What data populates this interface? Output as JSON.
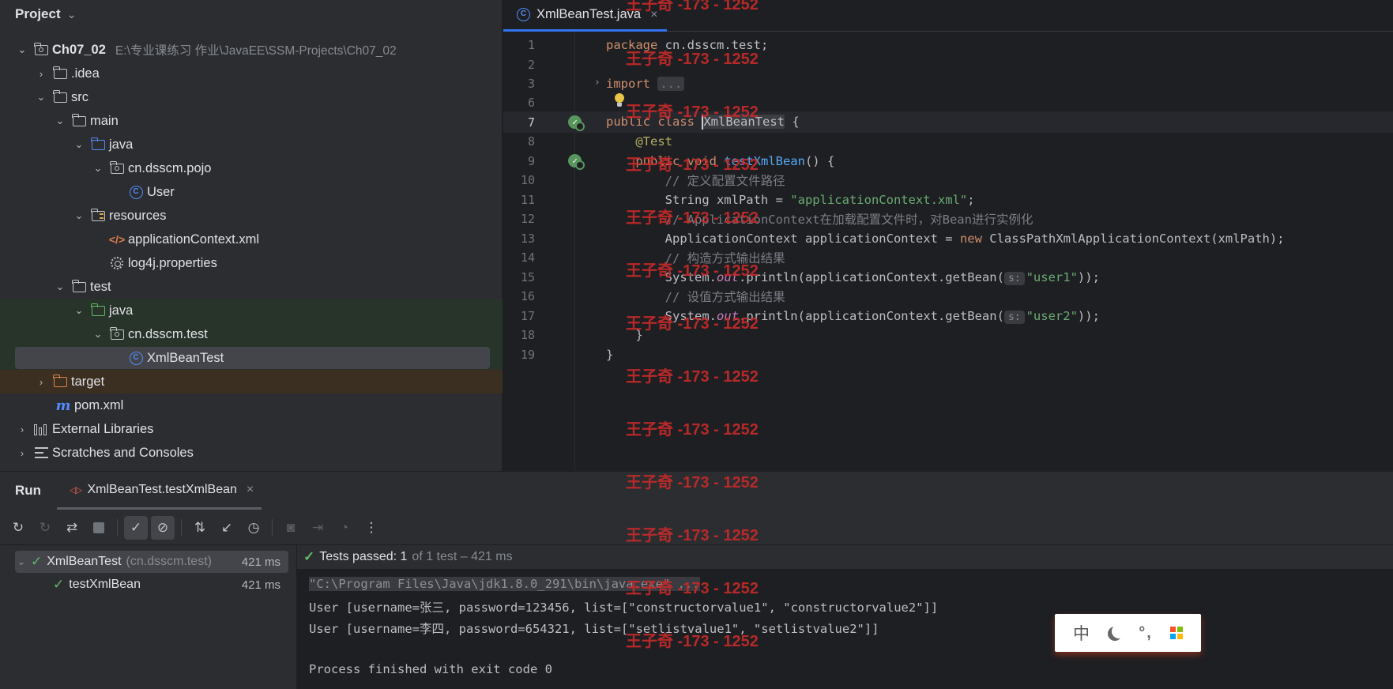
{
  "project": {
    "header": "Project",
    "tree": [
      {
        "label": "Ch07_02",
        "hint": "E:\\专业课练习 作业\\JavaEE\\SSM-Projects\\Ch07_02"
      },
      {
        "label": ".idea"
      },
      {
        "label": "src"
      },
      {
        "label": "main"
      },
      {
        "label": "java"
      },
      {
        "label": "cn.dsscm.pojo"
      },
      {
        "label": "User"
      },
      {
        "label": "resources"
      },
      {
        "label": "applicationContext.xml"
      },
      {
        "label": "log4j.properties"
      },
      {
        "label": "test"
      },
      {
        "label": "java"
      },
      {
        "label": "cn.dsscm.test"
      },
      {
        "label": "XmlBeanTest"
      },
      {
        "label": "target"
      },
      {
        "label": "pom.xml"
      },
      {
        "label": "External Libraries"
      },
      {
        "label": "Scratches and Consoles"
      }
    ]
  },
  "editor": {
    "tab_label": "XmlBeanTest.java",
    "line_numbers": [
      "1",
      "2",
      "3",
      "6",
      "7",
      "8",
      "9",
      "10",
      "11",
      "12",
      "13",
      "14",
      "15",
      "16",
      "17",
      "18",
      "19"
    ],
    "code": {
      "l1_kw": "package",
      "l1_rest": " cn.dsscm.test;",
      "l3_kw": "import",
      "l3_fold": "...",
      "l7_kw": "public class ",
      "l7_id": "XmlBeanTest",
      "l7_rest": " {",
      "l8_ann": "@Test",
      "l9_kw": "public void ",
      "l9_fn": "testXmlBean",
      "l9_rest": "() {",
      "l10_cmt": "// 定义配置文件路径",
      "l11_a": "String xmlPath = ",
      "l11_str": "\"applicationContext.xml\"",
      "l11_b": ";",
      "l12_cmt": "// ApplicationContext在加载配置文件时，对Bean进行实例化",
      "l13_a": "ApplicationContext applicationContext = ",
      "l13_kw": "new",
      "l13_b": " ClassPathXmlApplicationContext(xmlPath);",
      "l14_cmt": "// 构造方式输出结果",
      "sys": "System.",
      "out": "out",
      "l15_a": ".println(applicationContext.getBean(",
      "hint_s": "s:",
      "l15_str": "\"user1\"",
      "close": "));",
      "l16_cmt": "// 设值方式输出结果",
      "l17_str": "\"user2\"",
      "l18": "}",
      "l19": "}"
    }
  },
  "watermark": "王子奇 -173 - 1252",
  "run": {
    "title": "Run",
    "tab_label": "XmlBeanTest.testXmlBean",
    "tests": {
      "root_name": "XmlBeanTest",
      "root_pkg": "(cn.dsscm.test)",
      "root_time": "421 ms",
      "child_name": "testXmlBean",
      "child_time": "421 ms"
    },
    "status_passed": "Tests passed: 1",
    "status_detail": "of 1 test – 421 ms",
    "console": [
      "\"C:\\Program Files\\Java\\jdk1.8.0_291\\bin\\java.exe\" ...",
      "User [username=张三, password=123456, list=[\"constructorvalue1\", \"constructorvalue2\"]]",
      "User [username=李四, password=654321, list=[\"setlistvalue1\", \"setlistvalue2\"]]",
      "Process finished with exit code 0"
    ]
  },
  "ime": {
    "mode": "中",
    "punct": "°,"
  },
  "colors": {
    "accent": "#3574f0",
    "pass": "#5fb865",
    "watermark": "#c42a2a"
  }
}
